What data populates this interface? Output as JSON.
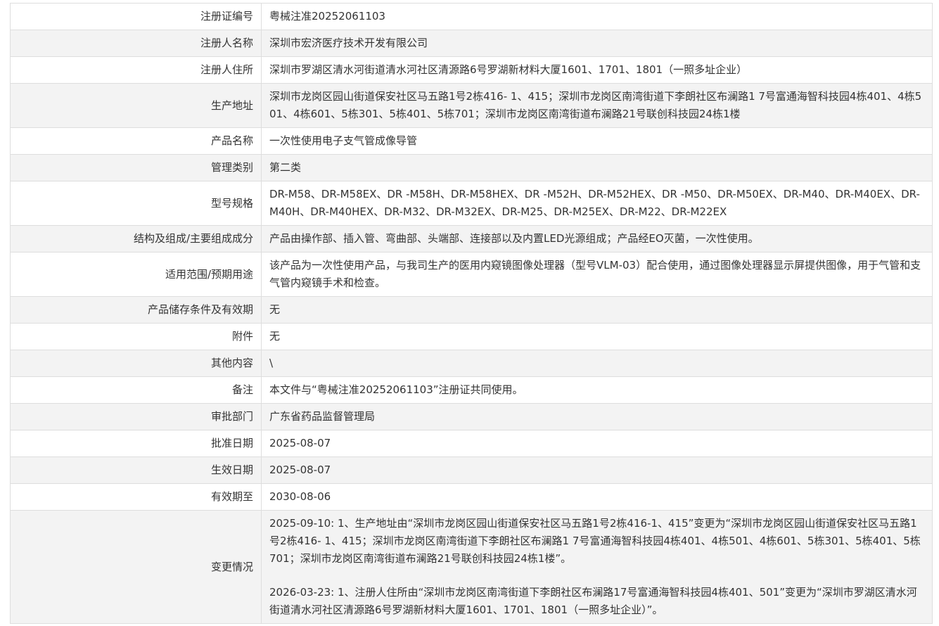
{
  "rows": [
    {
      "label": "注册证编号",
      "value": "粤械注准20252061103"
    },
    {
      "label": "注册人名称",
      "value": "深圳市宏济医疗技术开发有限公司"
    },
    {
      "label": "注册人住所",
      "value": "深圳市罗湖区清水河街道清水河社区清源路6号罗湖新材料大厦1601、1701、1801（一照多址企业）"
    },
    {
      "label": "生产地址",
      "value": "深圳市龙岗区园山街道保安社区马五路1号2栋416- 1、415；深圳市龙岗区南湾街道下李朗社区布澜路1 7号富通海智科技园4栋401、4栋501、4栋601、5栋301、5栋401、5栋701；深圳市龙岗区南湾街道布澜路21号联创科技园24栋1楼"
    },
    {
      "label": "产品名称",
      "value": "一次性使用电子支气管成像导管"
    },
    {
      "label": "管理类别",
      "value": "第二类"
    },
    {
      "label": "型号规格",
      "value": "DR-M58、DR-M58EX、DR -M58H、DR-M58HEX、DR -M52H、DR-M52HEX、DR -M50、DR-M50EX、DR-M40、DR-M40EX、DR-M40H、DR-M40HEX、DR-M32、DR-M32EX、DR-M25、DR-M25EX、DR-M22、DR-M22EX"
    },
    {
      "label": "结构及组成/主要组成成分",
      "value": "产品由操作部、插入管、弯曲部、头端部、连接部以及内置LED光源组成；产品经EO灭菌，一次性使用。"
    },
    {
      "label": "适用范围/预期用途",
      "value": "该产品为一次性使用产品，与我司生产的医用内窥镜图像处理器（型号VLM-03）配合使用，通过图像处理器显示屏提供图像，用于气管和支气管内窥镜手术和检查。"
    },
    {
      "label": "产品储存条件及有效期",
      "value": "无"
    },
    {
      "label": "附件",
      "value": "无"
    },
    {
      "label": "其他内容",
      "value": "\\"
    },
    {
      "label": "备注",
      "value": "本文件与“粤械注准20252061103”注册证共同使用。"
    },
    {
      "label": "审批部门",
      "value": "广东省药品监督管理局"
    },
    {
      "label": "批准日期",
      "value": "2025-08-07"
    },
    {
      "label": "生效日期",
      "value": "2025-08-07"
    },
    {
      "label": "有效期至",
      "value": "2030-08-06"
    }
  ],
  "changes": {
    "label": "变更情况",
    "entries": [
      "2025-09-10: 1、生产地址由“深圳市龙岗区园山街道保安社区马五路1号2栋416-1、415”变更为“深圳市龙岗区园山街道保安社区马五路1号2栋416- 1、415；深圳市龙岗区南湾街道下李朗社区布澜路1 7号富通海智科技园4栋401、4栋501、4栋601、5栋301、5栋401、5栋701；深圳市龙岗区南湾街道布澜路21号联创科技园24栋1楼”。",
      "2026-03-23: 1、注册人住所由“深圳市龙岗区南湾街道下李朗社区布澜路17号富通海智科技园4栋401、501”变更为“深圳市罗湖区清水河街道清水河社区清源路6号罗湖新材料大厦1601、1701、1801（一照多址企业）”。"
    ]
  }
}
